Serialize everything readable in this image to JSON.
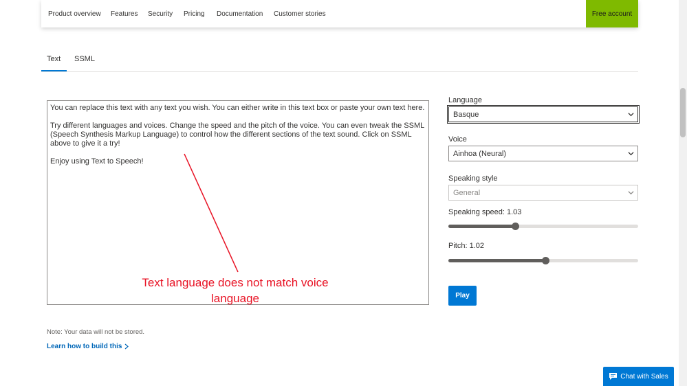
{
  "nav": {
    "links": [
      "Product overview",
      "Features",
      "Security",
      "Pricing",
      "Documentation",
      "Customer stories"
    ],
    "cta": "Free account",
    "cta_color": "#7fba00"
  },
  "tabs": [
    "Text",
    "SSML"
  ],
  "active_tab": "Text",
  "editor": {
    "paragraphs": [
      "You can replace this text with any text you wish. You can either write in this text box or paste your own text here.",
      "Try different languages and voices. Change the speed and the pitch of the voice. You can even tweak the SSML (Speech Synthesis Markup Language) to control how the different sections of the text sound. Click on SSML above to give it a try!",
      "Enjoy using Text to Speech!"
    ]
  },
  "annotation": {
    "text": "Text language does not match voice language",
    "color": "#e81123"
  },
  "settings": {
    "language_label": "Language",
    "language_value": "Basque",
    "voice_label": "Voice",
    "voice_value": "Ainhoa (Neural)",
    "style_label": "Speaking style",
    "style_value": "General",
    "speed_label": "Speaking speed: 1.03",
    "speed_fraction": 0.35,
    "pitch_label": "Pitch: 1.02",
    "pitch_fraction": 0.51,
    "play_label": "Play"
  },
  "footer": {
    "note": "Note: Your data will not be stored.",
    "learn_link": "Learn how to build this"
  },
  "chat": {
    "label": "Chat with Sales",
    "icon": "chat-bubble-icon"
  },
  "colors": {
    "accent": "#0078d4",
    "link": "#0067b8"
  }
}
